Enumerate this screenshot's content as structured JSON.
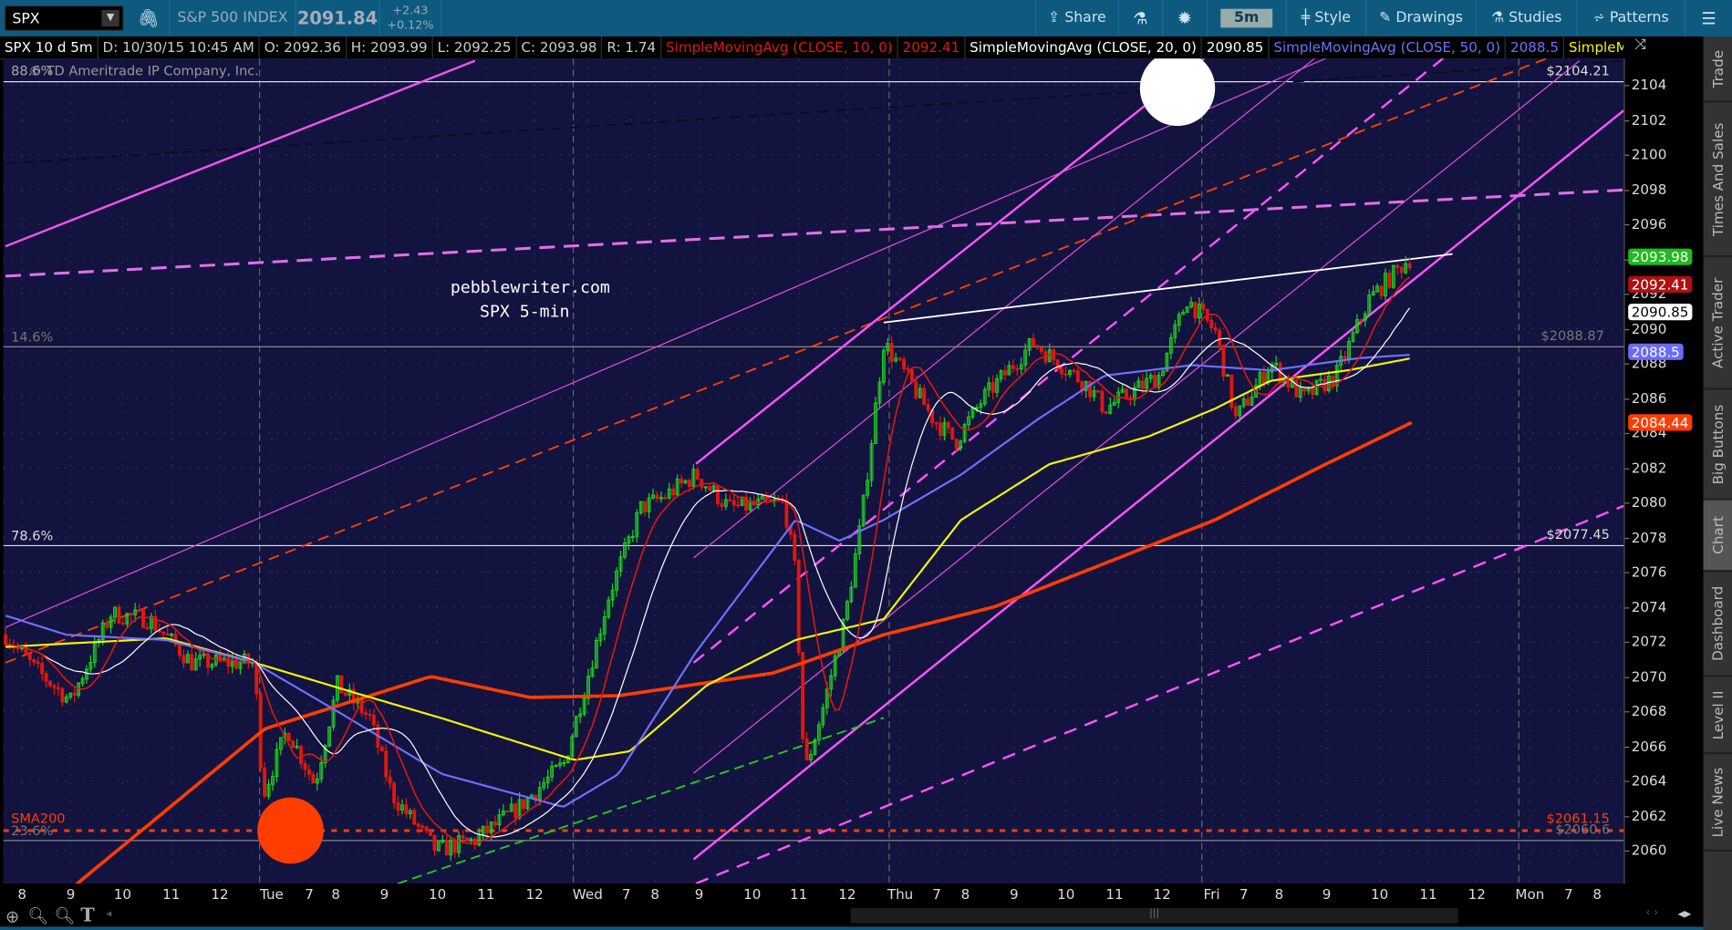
{
  "toolbar": {
    "symbol": "SPX",
    "description": "S&P 500 INDEX",
    "last": "2091.84",
    "change": "+2.43",
    "change_pct": "+0.12%",
    "share": "Share",
    "aggregation": "5m",
    "style": "Style",
    "drawings": "Drawings",
    "studies": "Studies",
    "patterns": "Patterns"
  },
  "legend": {
    "title": "SPX 10 d 5m",
    "date": "D: 10/30/15 10:45 AM",
    "open": "O: 2092.36",
    "high": "H: 2093.99",
    "low": "L: 2092.25",
    "close": "C: 2093.98",
    "range": "R: 1.74",
    "sma10": "SimpleMovingAvg (CLOSE, 10, 0)",
    "sma10_val": "2092.41",
    "sma20": "SimpleMovingAvg (CLOSE, 20, 0)",
    "sma20_val": "2090.85",
    "sma50": "SimpleMovingAvg (CLOSE, 50, 0)",
    "sma50_val": "2088.5",
    "sma_more": "SimpleMovingAvg ..."
  },
  "watermark": "© TD Ameritrade IP Company, Inc.",
  "annotation": {
    "line1": "pebblewriter.com",
    "line2": "SPX 5-min"
  },
  "fib_labels": {
    "f886": "88.6%",
    "f146": "14.6%",
    "f786": "78.6%",
    "f236": "23.6%",
    "sma200": "SMA200"
  },
  "price_lines": {
    "p1": "$2104.21",
    "p2": "$2088.87",
    "p3": "$2077.45",
    "p4": "$2061.15",
    "p5": "$2060.6"
  },
  "price_axis": [
    "2104",
    "2102",
    "2100",
    "2098",
    "2096",
    "2094",
    "2092",
    "2090",
    "2088",
    "2086",
    "2084",
    "2082",
    "2080",
    "2078",
    "2076",
    "2074",
    "2072",
    "2070",
    "2068",
    "2066",
    "2064",
    "2062",
    "2060"
  ],
  "badges": {
    "close": "2093.98",
    "sma10": "2092.41",
    "sma20": "2090.85",
    "sma50": "2088.5",
    "sma200": "2084.44"
  },
  "x_axis": [
    "8",
    "9",
    "10",
    "11",
    "12",
    "Tue",
    "7",
    "8",
    "9",
    "10",
    "11",
    "12",
    "Wed",
    "7",
    "8",
    "9",
    "10",
    "11",
    "12",
    "Thu",
    "7",
    "8",
    "9",
    "10",
    "11",
    "12",
    "Fri",
    "7",
    "8",
    "9",
    "10",
    "11",
    "12",
    "Mon",
    "7",
    "8"
  ],
  "sidebar": [
    "Trade",
    "Times And Sales",
    "Active Trader",
    "Big Buttons",
    "Chart",
    "Dashboard",
    "Level II",
    "Live News"
  ],
  "colors": {
    "up": "#1fd11f",
    "down": "#e0180c",
    "sma10": "#e0180c",
    "sma20": "#ffffff",
    "sma50": "#7070ff",
    "sma100": "#f5f500",
    "sma200": "#ff3d00",
    "bg": "#13133f"
  },
  "chart_data": {
    "type": "candlestick",
    "ylim": [
      2058.5,
      2105.5
    ],
    "close_path": [
      [
        14,
        2072.4
      ],
      [
        21,
        2070.5
      ],
      [
        30,
        2068.6
      ],
      [
        40,
        2073.6
      ],
      [
        49.5,
        2073.3
      ],
      [
        60,
        2070.8
      ],
      [
        75.4,
        2070.8
      ],
      [
        77.6,
        2063.2
      ],
      [
        83.6,
        2067
      ],
      [
        90.4,
        2063.8
      ],
      [
        96,
        2069.5
      ],
      [
        104,
        2067.6
      ],
      [
        109.5,
        2063.2
      ],
      [
        120.4,
        2060
      ],
      [
        130,
        2060.6
      ],
      [
        140.9,
        2062.5
      ],
      [
        152,
        2065
      ],
      [
        157.3,
        2069.5
      ],
      [
        163,
        2074.6
      ],
      [
        171,
        2079.7
      ],
      [
        176.4,
        2080.3
      ],
      [
        184.6,
        2081.6
      ],
      [
        192.8,
        2079.7
      ],
      [
        206.4,
        2080
      ],
      [
        209.2,
        2075.9
      ],
      [
        211.4,
        2064.4
      ],
      [
        216,
        2068.2
      ],
      [
        221.4,
        2073.3
      ],
      [
        225.5,
        2079
      ],
      [
        231,
        2089.2
      ],
      [
        236.5,
        2087.3
      ],
      [
        243.3,
        2084.8
      ],
      [
        248.8,
        2083.5
      ],
      [
        255.6,
        2086
      ],
      [
        267.9,
        2089.2
      ],
      [
        281.5,
        2086.7
      ],
      [
        285.6,
        2085.4
      ],
      [
        299,
        2087.3
      ],
      [
        306,
        2091.7
      ],
      [
        313,
        2089.8
      ],
      [
        318,
        2084.8
      ],
      [
        326.6,
        2088
      ],
      [
        334.7,
        2086
      ],
      [
        342.8,
        2087.3
      ],
      [
        351,
        2091.7
      ],
      [
        360.7,
        2094
      ]
    ],
    "sma50": [
      [
        14,
        2073.5
      ],
      [
        29,
        2072.4
      ],
      [
        53.6,
        2072.1
      ],
      [
        75.4,
        2070.8
      ],
      [
        94.5,
        2068.2
      ],
      [
        121.8,
        2064.4
      ],
      [
        151.8,
        2062.5
      ],
      [
        165.5,
        2064.4
      ],
      [
        184.6,
        2071.4
      ],
      [
        209.2,
        2079
      ],
      [
        220.1,
        2077.8
      ],
      [
        231,
        2079
      ],
      [
        250.1,
        2081.6
      ],
      [
        269.2,
        2084.8
      ],
      [
        285.6,
        2087.3
      ],
      [
        307.4,
        2087.9
      ],
      [
        326.6,
        2087.6
      ],
      [
        348.4,
        2088.3
      ],
      [
        361.5,
        2088.5
      ]
    ],
    "sma100": [
      [
        14,
        2071.7
      ],
      [
        53.6,
        2072.2
      ],
      [
        75.4,
        2070.8
      ],
      [
        102.7,
        2068.9
      ],
      [
        121.8,
        2067.6
      ],
      [
        154.6,
        2065.2
      ],
      [
        168.2,
        2065.7
      ],
      [
        187.3,
        2069.5
      ],
      [
        209.2,
        2072.1
      ],
      [
        231,
        2073.3
      ],
      [
        250.1,
        2079
      ],
      [
        271.9,
        2082.2
      ],
      [
        296.5,
        2083.8
      ],
      [
        312.9,
        2085.4
      ],
      [
        326.6,
        2087
      ],
      [
        345.7,
        2087.6
      ],
      [
        361.5,
        2088.3
      ]
    ],
    "sma200": [
      [
        23.5,
        2056.2
      ],
      [
        31.7,
        2058.1
      ],
      [
        78.1,
        2067
      ],
      [
        119.1,
        2070
      ],
      [
        143.6,
        2068.8
      ],
      [
        165.5,
        2068.9
      ],
      [
        203.7,
        2070.2
      ],
      [
        231,
        2072.4
      ],
      [
        258.3,
        2074
      ],
      [
        285.6,
        2076.5
      ],
      [
        312.9,
        2079
      ],
      [
        340.2,
        2082.2
      ],
      [
        361.5,
        2084.6
      ]
    ]
  }
}
